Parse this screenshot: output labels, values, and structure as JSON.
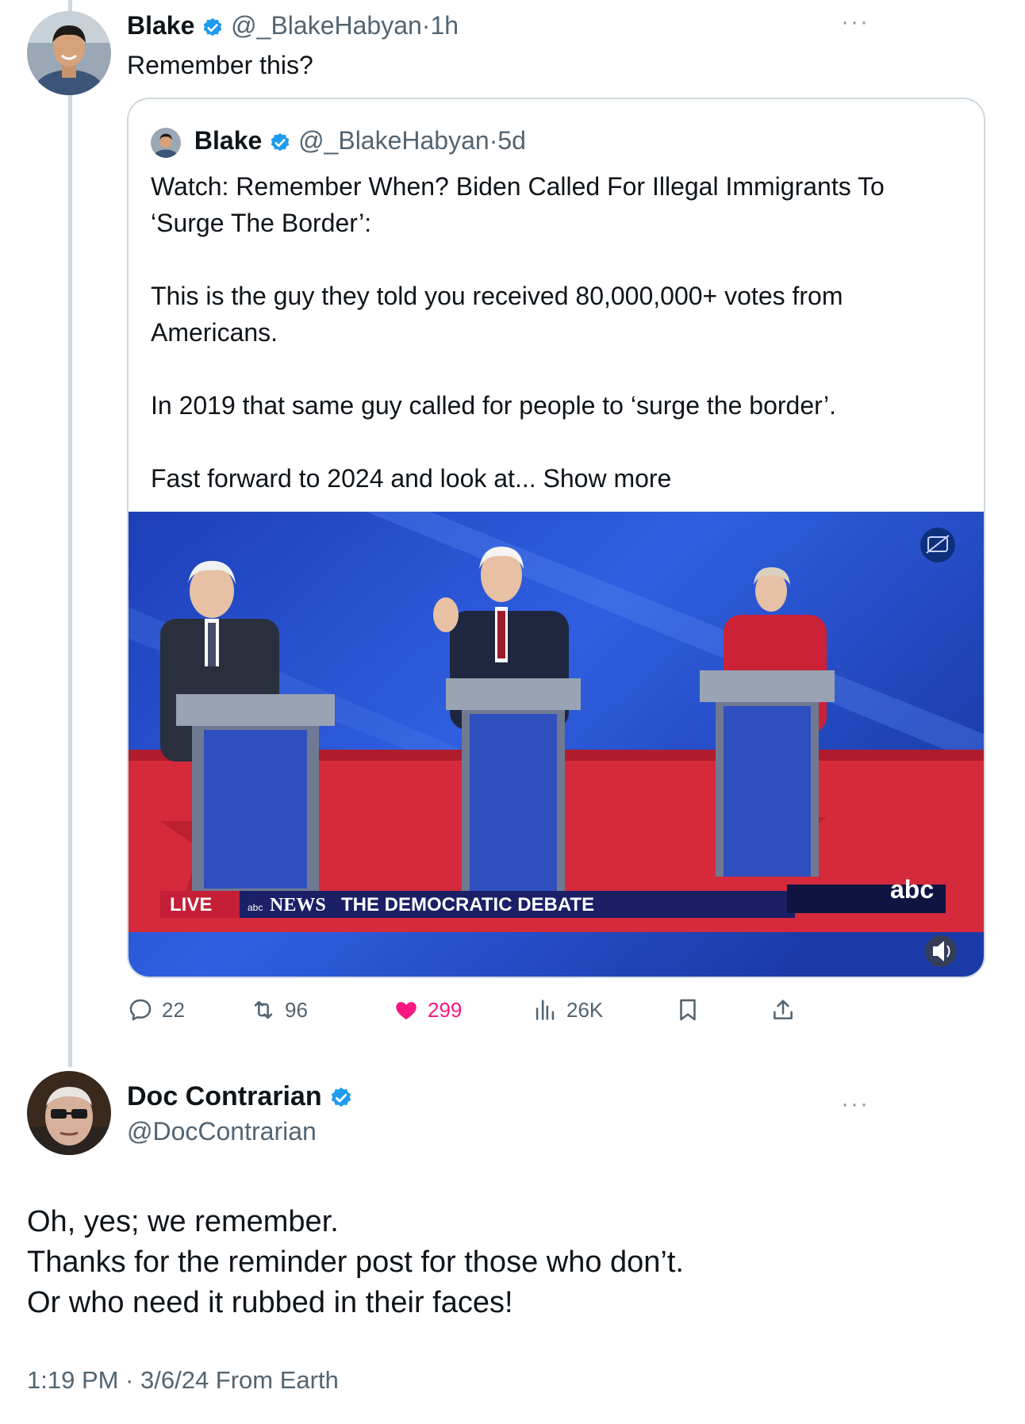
{
  "tweet1": {
    "author_name": "Blake",
    "handle": "@_BlakeHabyan",
    "separator": "·",
    "time": "1h",
    "text": "Remember this?",
    "avatar_icon": "profile-photo-young-man",
    "verified_icon": "verified-badge-icon",
    "verified_color": "#1d9bf0"
  },
  "quote": {
    "author_name": "Blake",
    "handle": "@_BlakeHabyan",
    "separator": "·",
    "time": "5d",
    "line1": "Watch: Remember When? Biden Called For Illegal Immigrants To",
    "line2": "‘Surge The Border’:",
    "para2_line1": "This is the guy they told you received 80,000,000+ votes from",
    "para2_line2": "Americans.",
    "para3": "In 2019 that same guy called for people to ‘surge the border’.",
    "para4_prefix": "Fast forward to 2024 and look at...",
    "show_more": "Show more",
    "video": {
      "live_label": "LIVE",
      "network_label": "NEWS",
      "network_prefix": "abc",
      "ticker": "THE DEMOCRATIC DEBATE",
      "corner_logo": "abc",
      "caption_icon": "captions-icon",
      "sound_icon": "speaker-muted-icon"
    }
  },
  "actions": {
    "replies": "22",
    "reposts": "96",
    "likes": "299",
    "views": "26K",
    "like_color": "#f91880"
  },
  "tweet2": {
    "author_name": "Doc Contrarian",
    "handle": "@DocContrarian",
    "line1": "Oh, yes; we remember.",
    "line2": "Thanks for the reminder post for those who don’t.",
    "line3": "Or who need it rubbed in their faces!",
    "timestamp": "1:19 PM · 3/6/24 From Earth",
    "avatar_icon": "profile-photo-older-man-glasses"
  }
}
